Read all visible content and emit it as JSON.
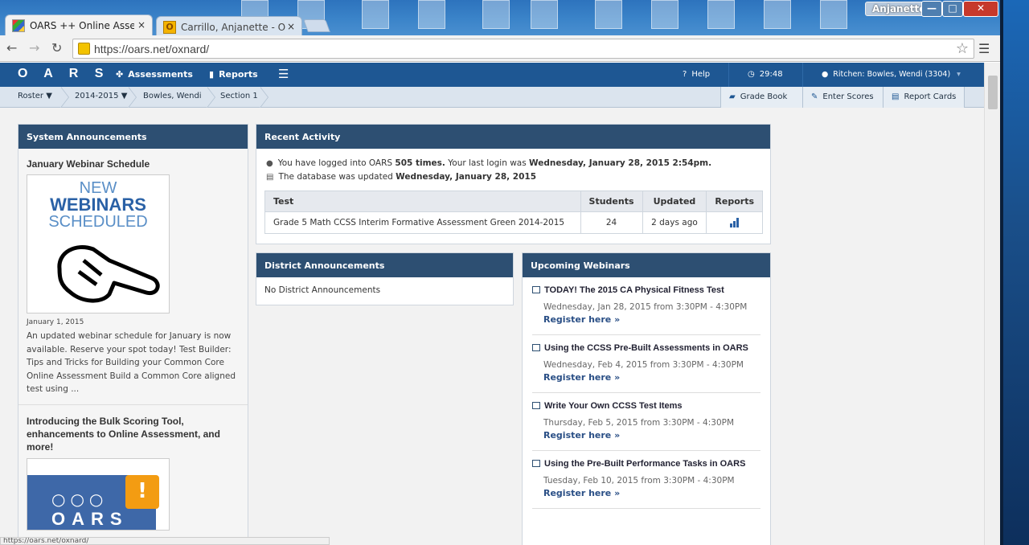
{
  "browser": {
    "tabs": [
      {
        "label": "OARS ++ Online Assessm",
        "close": "×"
      },
      {
        "label": "Carrillo, Anjanette - Outlo",
        "close": "×"
      }
    ],
    "url": "https://oars.net/oxnard/",
    "user_chip": "Anjanette",
    "status_url": "https://oars.net/oxnard/"
  },
  "appnav": {
    "logo": "O A R S",
    "assessments": "Assessments",
    "reports": "Reports",
    "help": "Help",
    "timer": "29:48",
    "user": "Ritchen: Bowles, Wendi (3304)"
  },
  "breadcrumbs": {
    "roster": "Roster",
    "year": "2014-2015",
    "teacher": "Bowles, Wendi",
    "section": "Section 1",
    "grade_book": "Grade Book",
    "enter_scores": "Enter Scores",
    "report_cards": "Report Cards"
  },
  "system_announcements": {
    "header": "System Announcements",
    "items": [
      {
        "title": "January Webinar Schedule",
        "image_lines": [
          "NEW",
          "WEBINARS",
          "SCHEDULED"
        ],
        "date": "January 1, 2015",
        "body": "An updated webinar schedule for January is now available. Reserve your spot today! Test Builder: Tips and Tricks for Building your Common Core Online Assessment Build a Common Core aligned test using ..."
      },
      {
        "title": "Introducing the Bulk Scoring Tool, enhancements to Online Assessment, and more!",
        "image_word": "OARS",
        "image_circles": "○○○",
        "image_bang": "!"
      }
    ]
  },
  "recent_activity": {
    "header": "Recent Activity",
    "login_prefix": "You have logged into OARS ",
    "login_count": "505 times.",
    "last_login_prefix": "  Your last login was ",
    "last_login": "Wednesday, January 28, 2015 2:54pm.",
    "db_prefix": "The database was updated ",
    "db_date": "Wednesday, January 28, 2015",
    "table": {
      "headers": [
        "Test",
        "Students",
        "Updated",
        "Reports"
      ],
      "rows": [
        {
          "test": "Grade 5 Math CCSS Interim Formative Assessment Green 2014-2015",
          "students": "24",
          "updated": "2 days ago"
        }
      ]
    }
  },
  "district_announcements": {
    "header": "District Announcements",
    "text": "No District Announcements"
  },
  "upcoming_webinars": {
    "header": "Upcoming Webinars",
    "items": [
      {
        "title": "TODAY! The 2015 CA Physical Fitness Test",
        "date": "Wednesday, Jan 28, 2015 from 3:30PM - 4:30PM",
        "link": "Register here »"
      },
      {
        "title": "Using the CCSS Pre-Built Assessments in OARS",
        "date": "Wednesday, Feb 4, 2015 from 3:30PM - 4:30PM",
        "link": "Register here »"
      },
      {
        "title": "Write Your Own CCSS Test Items",
        "date": "Thursday, Feb 5, 2015 from 3:30PM - 4:30PM",
        "link": "Register here »"
      },
      {
        "title": "Using the Pre-Built Performance Tasks in OARS",
        "date": "Tuesday, Feb 10, 2015 from 3:30PM - 4:30PM",
        "link": "Register here »"
      }
    ]
  },
  "icons": [
    "oars-favicon-icon",
    "outlook-favicon-icon",
    "back-icon",
    "forward-icon",
    "reload-icon",
    "lock-icon",
    "star-icon",
    "menu-icon",
    "assessments-icon",
    "reports-icon",
    "menu-list-icon",
    "help-icon",
    "clock-icon",
    "user-icon",
    "dropdown-icon",
    "gradebook-icon",
    "pencil-icon",
    "report-card-icon",
    "person-icon",
    "database-icon",
    "bar-chart-icon",
    "checkbox-icon"
  ]
}
